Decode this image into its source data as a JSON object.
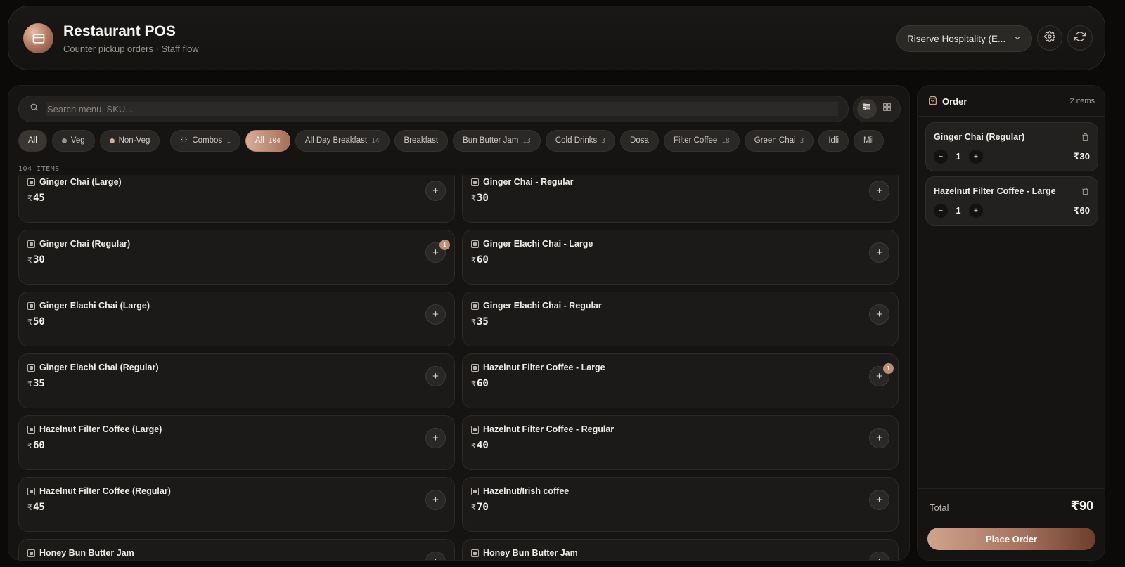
{
  "header": {
    "title": "Restaurant POS",
    "subtitle": "Counter pickup orders · Staff flow",
    "org_select": "Riserve Hospitality (E..."
  },
  "search": {
    "placeholder": "Search menu, SKU..."
  },
  "filters": [
    {
      "label": "All",
      "type": "all"
    },
    {
      "label": "Veg",
      "type": "veg",
      "dot_color": "#9a9590"
    },
    {
      "label": "Non-Veg",
      "type": "nonveg",
      "dot_color": "#d9a896"
    }
  ],
  "categories": [
    {
      "label": "Combos",
      "count": "1",
      "icon": "sparkle-icon"
    },
    {
      "label": "All",
      "count": "104",
      "active": true
    },
    {
      "label": "All Day Breakfast",
      "count": "14"
    },
    {
      "label": "Breakfast",
      "count": ""
    },
    {
      "label": "Bun Butter Jam",
      "count": "13"
    },
    {
      "label": "Cold Drinks",
      "count": "3"
    },
    {
      "label": "Dosa",
      "count": ""
    },
    {
      "label": "Filter Coffee",
      "count": "18"
    },
    {
      "label": "Green Chai",
      "count": "3"
    },
    {
      "label": "Idli",
      "count": ""
    },
    {
      "label": "Mil",
      "count": ""
    }
  ],
  "items_count_label": "104 ITEMS",
  "currency": "₹",
  "menu_items": [
    {
      "name": "Ginger Chai (Large)",
      "price": "45",
      "qty": ""
    },
    {
      "name": "Ginger Chai - Regular",
      "price": "30",
      "qty": ""
    },
    {
      "name": "Ginger Chai (Regular)",
      "price": "30",
      "qty": "1"
    },
    {
      "name": "Ginger Elachi Chai - Large",
      "price": "60",
      "qty": ""
    },
    {
      "name": "Ginger Elachi Chai (Large)",
      "price": "50",
      "qty": ""
    },
    {
      "name": "Ginger Elachi Chai - Regular",
      "price": "35",
      "qty": ""
    },
    {
      "name": "Ginger Elachi Chai (Regular)",
      "price": "35",
      "qty": ""
    },
    {
      "name": "Hazelnut Filter Coffee - Large",
      "price": "60",
      "qty": "1"
    },
    {
      "name": "Hazelnut Filter Coffee (Large)",
      "price": "60",
      "qty": ""
    },
    {
      "name": "Hazelnut Filter Coffee - Regular",
      "price": "40",
      "qty": ""
    },
    {
      "name": "Hazelnut Filter Coffee (Regular)",
      "price": "45",
      "qty": ""
    },
    {
      "name": "Hazelnut/Irish coffee",
      "price": "70",
      "qty": ""
    },
    {
      "name": "Honey Bun Butter Jam",
      "price": "",
      "qty": ""
    },
    {
      "name": "Honey Bun Butter Jam",
      "price": "",
      "qty": ""
    }
  ],
  "order": {
    "title": "Order",
    "count_label": "2 items",
    "items": [
      {
        "name": "Ginger Chai (Regular)",
        "qty": "1",
        "price": "₹30"
      },
      {
        "name": "Hazelnut Filter Coffee - Large",
        "qty": "1",
        "price": "₹60"
      }
    ],
    "total_label": "Total",
    "total_value": "₹90",
    "place_button": "Place Order"
  }
}
